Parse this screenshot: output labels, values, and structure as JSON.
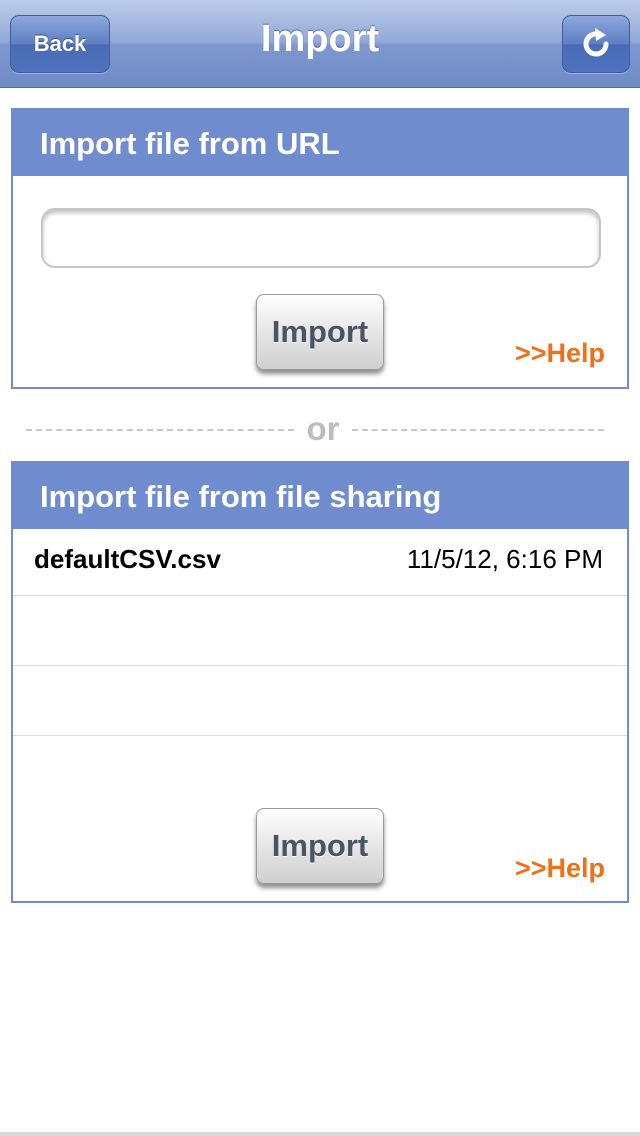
{
  "navbar": {
    "title": "Import",
    "back_label": "Back",
    "refresh_icon": "refresh-icon"
  },
  "url_panel": {
    "header": "Import file from URL",
    "url_input_value": "",
    "import_label": "Import",
    "help_label": ">>Help"
  },
  "separator": {
    "label": "or"
  },
  "sharing_panel": {
    "header": "Import file from file sharing",
    "files": [
      {
        "name": "defaultCSV.csv",
        "date": "11/5/12, 6:16 PM"
      },
      {
        "name": "",
        "date": ""
      },
      {
        "name": "",
        "date": ""
      }
    ],
    "import_label": "Import",
    "help_label": ">>Help"
  },
  "colors": {
    "accent": "#6f8ccf",
    "help_link": "#f07018"
  }
}
